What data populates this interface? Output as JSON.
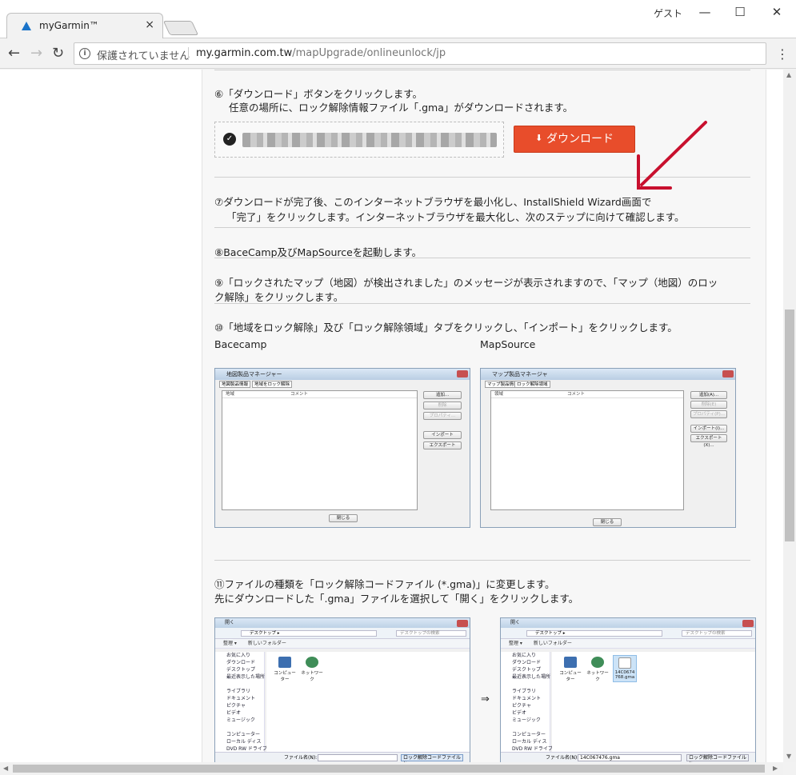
{
  "browser": {
    "tab_title": "myGarmin™",
    "tab_close": "×",
    "profile": "ゲスト",
    "window_controls": {
      "minimize": "—",
      "maximize": "☐",
      "close": "✕"
    },
    "nav": {
      "back": "←",
      "forward": "→",
      "reload": "↻"
    },
    "security_icon": "i",
    "security_text": "保護されていません",
    "url_host": "my.garmin.com.tw",
    "url_path": "/mapUpgrade/onlineunlock/jp",
    "menu": "⋮"
  },
  "steps": {
    "step6_line1": "⑥「ダウンロード」ボタンをクリックします。",
    "step6_line2": "任意の場所に、ロック解除情報ファイル「.gma」がダウンロードされます。",
    "download_button": "ダウンロード",
    "step7_line1": "⑦ダウンロードが完了後、このインターネットブラウザを最小化し、InstallShield Wizard画面で",
    "step7_line2": "「完了」をクリックします。インターネットブラウザを最大化し、次のステップに向けて確認します。",
    "step8": "⑧BaceCamp及びMapSourceを起動します。",
    "step9_line1": "⑨「ロックされたマップ（地図）が検出されました」のメッセージが表示されますので、「マップ（地図）のロッ",
    "step9_line2": "ク解除」をクリックします。",
    "step10": "⑩「地域をロック解除」及び「ロック解除領域」タブをクリックし、「インポート」をクリックします。",
    "label_basecamp": "Bacecamp",
    "label_mapsource": "MapSource",
    "step11_line1": "⑪ファイルの種類を「ロック解除コードファイル (*.gma)」に変更します。",
    "step11_line2": "先にダウンロードした「.gma」ファイルを選択して「開く」をクリックします。",
    "arrow": "⇒"
  },
  "basecamp_dialog": {
    "title": "地図製品マネージャー",
    "tab1": "地図製品情報",
    "tab2": "地域をロック解除",
    "col1": "地域",
    "col2": "コメント",
    "btn_add": "追加...",
    "btn_delete": "削除",
    "btn_props": "プロパティ...",
    "btn_import": "インポート",
    "btn_export": "エクスポート",
    "btn_close": "閉じる"
  },
  "mapsource_dialog": {
    "title": "マップ製品マネージャ",
    "tab1": "マップ製品情報",
    "tab2": "ロック解除領域",
    "col1": "領域",
    "col2": "コメント",
    "btn_add": "追加(A)...",
    "btn_delete": "削除(E)",
    "btn_props": "プロパティ(P)...",
    "btn_import": "インポート(I)...",
    "btn_export": "エクスポート(X)...",
    "btn_close": "閉じる"
  },
  "open_dialog": {
    "title": "開く",
    "path": "デスクトップ ▸",
    "search": "デスクトップの検索",
    "organize": "整理 ▾",
    "new_folder": "新しいフォルダー",
    "nav_items": [
      "お気に入り",
      "ダウンロード",
      "デスクトップ",
      "最近表示した場所",
      "",
      "ライブラリ",
      "ドキュメント",
      "ピクチャ",
      "ビデオ",
      "ミュージック",
      "",
      "コンピューター",
      "ローカル ディス",
      "DVD RW ドライブ"
    ],
    "file_computer": "コンピューター",
    "file_network": "ネットワーク",
    "file_gma": "14C0674768.gma",
    "filename_label": "ファイル名(N):",
    "filename_value_left": "",
    "filename_value_right": "14C067476.gma",
    "filetype": "ロック解除コードファイル (*.g ▾"
  },
  "colors": {
    "download_button": "#e84d2b",
    "pointer_arrow": "#c8102e",
    "page_bg": "#f7f7f7"
  }
}
